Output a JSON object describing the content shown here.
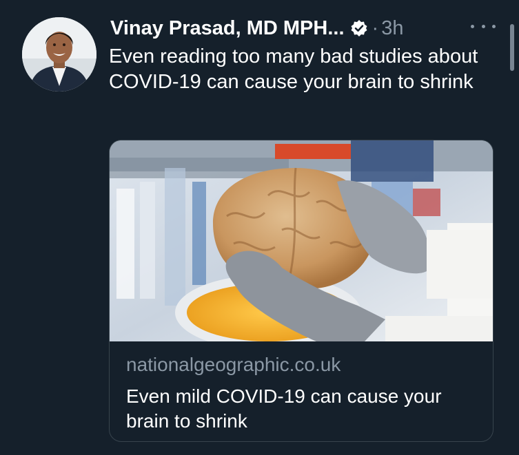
{
  "tweet": {
    "author_name": "Vinay Prasad, MD MPH...",
    "verified": true,
    "separator": "·",
    "timestamp": "3h",
    "text": "Even reading too many bad studies about COVID-19 can cause your brain to shrink"
  },
  "card": {
    "domain": "nationalgeographic.co.uk",
    "title": "Even mild COVID-19 can cause your brain to shrink"
  },
  "colors": {
    "background": "#15202b",
    "secondary_text": "#8b98a5",
    "border": "#38444d"
  },
  "icons": {
    "verified": "verified-badge-icon",
    "more": "more-options-icon"
  }
}
